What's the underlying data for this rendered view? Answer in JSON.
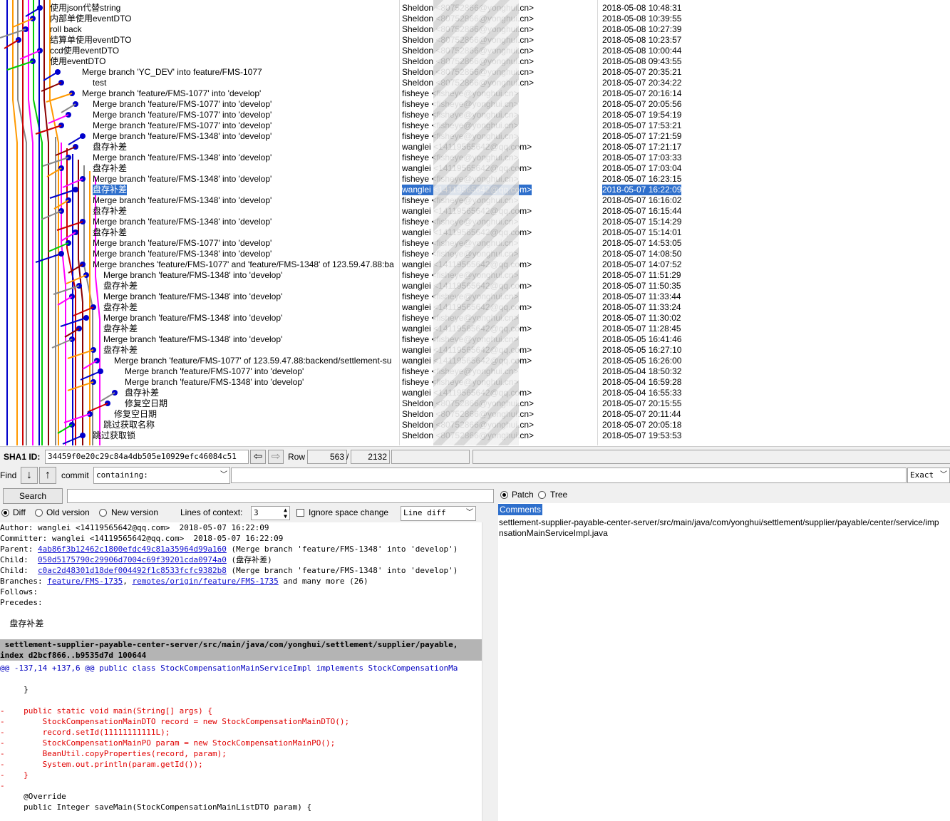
{
  "commits": [
    {
      "msg": "使用json代替string",
      "author": "Sheldon <80752866@yonghui.cn>",
      "date": "2018-05-08 10:48:31",
      "indent": 70
    },
    {
      "msg": "内部单使用eventDTO",
      "author": "Sheldon <80752866@yonghui.cn>",
      "date": "2018-05-08 10:39:55",
      "indent": 70
    },
    {
      "msg": "roll back",
      "author": "Sheldon <80752866@yonghui.cn>",
      "date": "2018-05-08 10:27:39",
      "indent": 70
    },
    {
      "msg": "结算单使用eventDTO",
      "author": "Sheldon <80752866@yonghui.cn>",
      "date": "2018-05-08 10:23:57",
      "indent": 70
    },
    {
      "msg": "ccd使用eventDTO",
      "author": "Sheldon <80752866@yonghui.cn>",
      "date": "2018-05-08 10:00:44",
      "indent": 70
    },
    {
      "msg": "使用eventDTO",
      "author": "Sheldon <80752866@yonghui.cn>",
      "date": "2018-05-08 09:43:55",
      "indent": 70
    },
    {
      "msg": "Merge branch 'YC_DEV' into feature/FMS-1077",
      "author": "Sheldon <80752866@yonghui.cn>",
      "date": "2018-05-07 20:35:21",
      "indent": 115
    },
    {
      "msg": "test",
      "author": "Sheldon <80752866@yonghui.cn>",
      "date": "2018-05-07 20:34:22",
      "indent": 130
    },
    {
      "msg": "Merge branch 'feature/FMS-1077' into 'develop'",
      "author": "fisheye <fisheye@yonghui.cn>",
      "date": "2018-05-07 20:16:14",
      "indent": 115
    },
    {
      "msg": "Merge branch 'feature/FMS-1077' into 'develop'",
      "author": "fisheye <fisheye@yonghui.cn>",
      "date": "2018-05-07 20:05:56",
      "indent": 130
    },
    {
      "msg": "Merge branch 'feature/FMS-1077' into 'develop'",
      "author": "fisheye <fisheye@yonghui.cn>",
      "date": "2018-05-07 19:54:19",
      "indent": 130
    },
    {
      "msg": "Merge branch 'feature/FMS-1077' into 'develop'",
      "author": "fisheye <fisheye@yonghui.cn>",
      "date": "2018-05-07 17:53:21",
      "indent": 130
    },
    {
      "msg": "Merge branch 'feature/FMS-1348' into 'develop'",
      "author": "fisheye <fisheye@yonghui.cn>",
      "date": "2018-05-07 17:21:59",
      "indent": 130
    },
    {
      "msg": "盘存补差",
      "author": "wanglei <14119565642@qq.com>",
      "date": "2018-05-07 17:21:17",
      "indent": 130
    },
    {
      "msg": "Merge branch 'feature/FMS-1348' into 'develop'",
      "author": "fisheye <fisheye@yonghui.cn>",
      "date": "2018-05-07 17:03:33",
      "indent": 130
    },
    {
      "msg": "盘存补差",
      "author": "wanglei <14119565642@qq.com>",
      "date": "2018-05-07 17:03:04",
      "indent": 130
    },
    {
      "msg": "Merge branch 'feature/FMS-1348' into 'develop'",
      "author": "fisheye <fisheye@yonghui.cn>",
      "date": "2018-05-07 16:23:15",
      "indent": 130
    },
    {
      "msg": "盘存补差",
      "author": "wanglei <14119565642@qq.com>",
      "date": "2018-05-07 16:22:09",
      "indent": 130,
      "selected": true
    },
    {
      "msg": "Merge branch 'feature/FMS-1348' into 'develop'",
      "author": "fisheye <fisheye@yonghui.cn>",
      "date": "2018-05-07 16:16:02",
      "indent": 130
    },
    {
      "msg": "盘存补差",
      "author": "wanglei <14119565642@qq.com>",
      "date": "2018-05-07 16:15:44",
      "indent": 130
    },
    {
      "msg": "Merge branch 'feature/FMS-1348' into 'develop'",
      "author": "fisheye <fisheye@yonghui.cn>",
      "date": "2018-05-07 15:14:29",
      "indent": 130
    },
    {
      "msg": "盘存补差",
      "author": "wanglei <14119565642@qq.com>",
      "date": "2018-05-07 15:14:01",
      "indent": 130
    },
    {
      "msg": "Merge branch 'feature/FMS-1077' into 'develop'",
      "author": "fisheye <fisheye@yonghui.cn>",
      "date": "2018-05-07 14:53:05",
      "indent": 130
    },
    {
      "msg": "Merge branch 'feature/FMS-1348' into 'develop'",
      "author": "fisheye <fisheye@yonghui.cn>",
      "date": "2018-05-07 14:08:50",
      "indent": 130
    },
    {
      "msg": "Merge branches 'feature/FMS-1077' and 'feature/FMS-1348' of 123.59.47.88:ba",
      "author": "wanglei <14119565642@qq.com>",
      "date": "2018-05-07 14:07:52",
      "indent": 130
    },
    {
      "msg": "Merge branch 'feature/FMS-1348' into 'develop'",
      "author": "fisheye <fisheye@yonghui.cn>",
      "date": "2018-05-07 11:51:29",
      "indent": 145
    },
    {
      "msg": "盘存补差",
      "author": "wanglei <14119565642@qq.com>",
      "date": "2018-05-07 11:50:35",
      "indent": 145
    },
    {
      "msg": "Merge branch 'feature/FMS-1348' into 'develop'",
      "author": "fisheye <fisheye@yonghui.cn>",
      "date": "2018-05-07 11:33:44",
      "indent": 145
    },
    {
      "msg": "盘存补差",
      "author": "wanglei <14119565642@qq.com>",
      "date": "2018-05-07 11:33:24",
      "indent": 145
    },
    {
      "msg": "Merge branch 'feature/FMS-1348' into 'develop'",
      "author": "fisheye <fisheye@yonghui.cn>",
      "date": "2018-05-07 11:30:02",
      "indent": 145
    },
    {
      "msg": "盘存补差",
      "author": "wanglei <14119565642@qq.com>",
      "date": "2018-05-07 11:28:45",
      "indent": 145
    },
    {
      "msg": "Merge branch 'feature/FMS-1348' into 'develop'",
      "author": "fisheye <fisheye@yonghui.cn>",
      "date": "2018-05-05 16:41:46",
      "indent": 145
    },
    {
      "msg": "盘存补差",
      "author": "wanglei <14119565642@qq.com>",
      "date": "2018-05-05 16:27:10",
      "indent": 145
    },
    {
      "msg": "Merge branch 'feature/FMS-1077' of 123.59.47.88:backend/settlement-su",
      "author": "wanglei <14119565642@qq.com>",
      "date": "2018-05-05 16:26:00",
      "indent": 160
    },
    {
      "msg": "Merge branch 'feature/FMS-1077' into 'develop'",
      "author": "fisheye <fisheye@yonghui.cn>",
      "date": "2018-05-04 18:50:32",
      "indent": 175
    },
    {
      "msg": "Merge branch 'feature/FMS-1348' into 'develop'",
      "author": "fisheye <fisheye@yonghui.cn>",
      "date": "2018-05-04 16:59:28",
      "indent": 175
    },
    {
      "msg": "盘存补差",
      "author": "wanglei <14119565642@qq.com>",
      "date": "2018-05-04 16:55:33",
      "indent": 175
    },
    {
      "msg": "修复空日期",
      "author": "Sheldon <80752866@yonghui.cn>",
      "date": "2018-05-07 20:15:55",
      "indent": 175
    },
    {
      "msg": "修复空日期",
      "author": "Sheldon <80752866@yonghui.cn>",
      "date": "2018-05-07 20:11:44",
      "indent": 160
    },
    {
      "msg": "跳过获取名称",
      "author": "Sheldon <80752866@yonghui.cn>",
      "date": "2018-05-07 20:05:18",
      "indent": 145
    },
    {
      "msg": "跳过获取锁",
      "author": "Sheldon <80752866@yonghui.cn>",
      "date": "2018-05-07 19:53:53",
      "indent": 130
    }
  ],
  "toolbar": {
    "sha1_label": "SHA1 ID:",
    "sha1_value": "34459f0e20c29c84a4db505e10929efc46084c51",
    "row_label": "Row",
    "row_current": "563",
    "row_sep": "/",
    "row_total": "2132",
    "find_label": "Find",
    "commit_label": "commit",
    "find_mode": "containing:",
    "find_match": "Exact",
    "search_button": "Search",
    "diff_label": "Diff",
    "old_version_label": "Old version",
    "new_version_label": "New version",
    "context_label": "Lines of context:",
    "context_value": "3",
    "ignore_space_label": "Ignore space change",
    "diff_mode": "Line diff",
    "patch_label": "Patch",
    "tree_label": "Tree"
  },
  "details": {
    "author": "Author: wanglei <14119565642@qq.com>  2018-05-07 16:22:09",
    "committer": "Committer: wanglei <14119565642@qq.com>  2018-05-07 16:22:09",
    "parent_label": "Parent: ",
    "parent_sha": "4ab86f3b12462c1800efdc49c81a35964d99a160",
    "parent_desc": " (Merge branch 'feature/FMS-1348' into 'develop')",
    "child1_label": "Child:  ",
    "child1_sha": "050d5175790c29906d7004c69f39201cda0974a0",
    "child1_desc": " (盘存补差)",
    "child2_label": "Child:  ",
    "child2_sha": "c0ac2d48301d18def004492f1c8533fcfc9382b8",
    "child2_desc": " (Merge branch 'feature/FMS-1348' into 'develop')",
    "branches_label": "Branches: ",
    "branch1": "feature/FMS-1735",
    "branch_sep": ", ",
    "branch2": "remotes/origin/feature/FMS-1735",
    "branches_more": " and many more (26)",
    "follows": "Follows:",
    "precedes": "Precedes:",
    "message": "    盘存补差"
  },
  "diff": {
    "file_header": " settlement-supplier-payable-center-server/src/main/java/com/yonghui/settlement/supplier/payable,",
    "index_line": "index d2bcf866..b9535d7d 100644",
    "hunk": "@@ -137,14 +137,6 @@ public class StockCompensationMainServiceImpl implements StockCompensationMa",
    "lines": [
      {
        "t": "ctx",
        "s": "     }"
      },
      {
        "t": "ctx",
        "s": ""
      },
      {
        "t": "rm",
        "s": "-    public static void main(String[] args) {"
      },
      {
        "t": "rm",
        "s": "-        StockCompensationMainDTO record = new StockCompensationMainDTO();"
      },
      {
        "t": "rm",
        "s": "-        record.setId(11111111111L);"
      },
      {
        "t": "rm",
        "s": "-        StockCompensationMainPO param = new StockCompensationMainPO();"
      },
      {
        "t": "rm",
        "s": "-        BeanUtil.copyProperties(record, param);"
      },
      {
        "t": "rm",
        "s": "-        System.out.println(param.getId());"
      },
      {
        "t": "rm",
        "s": "-    }"
      },
      {
        "t": "rm",
        "s": "-"
      },
      {
        "t": "ctx",
        "s": "     @Override"
      },
      {
        "t": "ctx",
        "s": "     public Integer saveMain(StockCompensationMainListDTO param) {"
      }
    ]
  },
  "files_pane": {
    "comments": "Comments",
    "file_line1": "settlement-supplier-payable-center-server/src/main/java/com/yonghui/settlement/supplier/payable/center/service/imp",
    "file_line2": "nsationMainServiceImpl.java"
  },
  "colors": {
    "selection": "#2e6fcc",
    "removed": "#e00000",
    "link": "#1010d0",
    "hunk": "#0000c0"
  }
}
